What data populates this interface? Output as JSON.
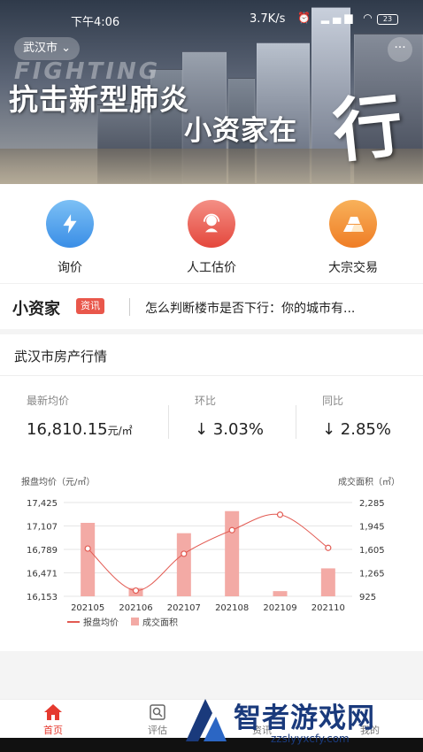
{
  "status_bar": {
    "time": "下午4:06",
    "network_speed": "3.7K/s",
    "battery": "23"
  },
  "banner": {
    "city_selector": "武汉市",
    "bg_text": "FIGHTING",
    "headline_1": "抗击新型肺炎",
    "headline_2": "小资家在",
    "calligraphy": "行动"
  },
  "actions": [
    {
      "label": "询价",
      "icon": "lightning-icon",
      "color": "#4a9be8"
    },
    {
      "label": "人工估价",
      "icon": "customer-service-icon",
      "color": "#e9574b"
    },
    {
      "label": "大宗交易",
      "icon": "gold-bars-icon",
      "color": "#f08a2c"
    }
  ],
  "news": {
    "brand": "小资家",
    "tag": "资讯",
    "headline": "怎么判断楼市是否下行：你的城市有..."
  },
  "market": {
    "title": "武汉市房产行情",
    "stats": [
      {
        "label": "最新均价",
        "value": "16,810.15",
        "unit": "元/㎡"
      },
      {
        "label": "环比",
        "value": "↓ 3.03%"
      },
      {
        "label": "同比",
        "value": "↓ 2.85%"
      }
    ]
  },
  "chart_data": {
    "type": "bar",
    "categories": [
      "202105",
      "202106",
      "202107",
      "202108",
      "202109",
      "202110"
    ],
    "ylabel_left": "报盘均价（元/㎡）",
    "ylabel_right": "成交面积（㎡）",
    "ylim_left": [
      16153,
      17425
    ],
    "ylim_right": [
      925,
      2285
    ],
    "yticks_left": [
      "17,425",
      "17,107",
      "16,789",
      "16,471",
      "16,153"
    ],
    "yticks_right": [
      "2,285",
      "1,945",
      "1,605",
      "1,265",
      "925"
    ],
    "series": [
      {
        "name": "报盘均价",
        "type": "line",
        "axis": "left",
        "color": "#e25a52",
        "values": [
          16800,
          16230,
          16730,
          17050,
          17260,
          16810
        ]
      },
      {
        "name": "成交面积",
        "type": "bar",
        "axis": "right",
        "color": "#f3aaa5",
        "values": [
          1990,
          1045,
          1840,
          2160,
          1000,
          1330
        ]
      }
    ],
    "legend": "bottom-left",
    "grid": true
  },
  "tabbar": [
    {
      "label": "首页",
      "icon": "home-icon",
      "active": true
    },
    {
      "label": "评估",
      "icon": "assessment-icon",
      "active": false
    },
    {
      "label": "资讯",
      "icon": "news-icon",
      "active": false
    },
    {
      "label": "我的",
      "icon": "user-icon",
      "active": false
    }
  ],
  "watermark": {
    "title": "智者游戏网",
    "url": "zzslyyxcfy.com"
  }
}
